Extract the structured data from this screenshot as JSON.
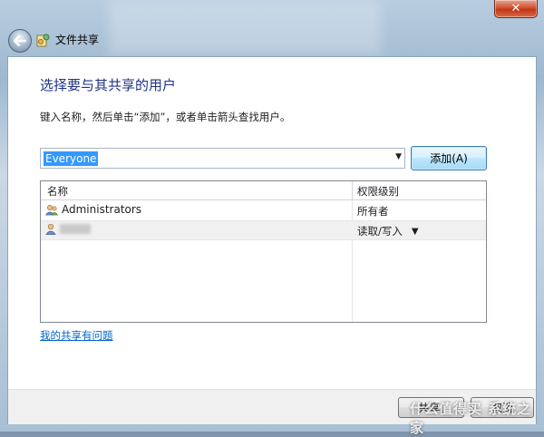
{
  "window": {
    "title": "文件共享",
    "close_glyph": "✕"
  },
  "main": {
    "heading": "选择要与其共享的用户",
    "instruction": "键入名称，然后单击“添加”，或者单击箭头查找用户。",
    "combo_value": "Everyone",
    "add_label": "添加(A)"
  },
  "table": {
    "columns": [
      "名称",
      "权限级别"
    ],
    "rows": [
      {
        "name": "Administrators",
        "permission": "所有者",
        "icon": "user-group-icon"
      },
      {
        "name": "",
        "permission": "读取/写入",
        "icon": "user-icon"
      }
    ]
  },
  "help_link": "我的共享有问题",
  "footer": {
    "share_label": "共享(",
    "cancel_label": "取消"
  },
  "watermark": "什么值得买 系统之家"
}
